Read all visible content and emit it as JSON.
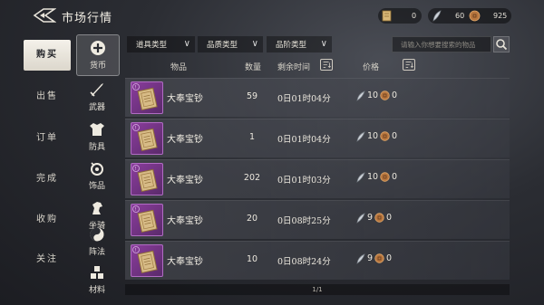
{
  "header": {
    "title": "市场行情"
  },
  "currency": [
    {
      "icon": "scroll-currency-icon",
      "value": "0"
    },
    {
      "icon": "feather-currency-icon",
      "value": "60"
    },
    {
      "icon": "coin-currency-icon",
      "value": "925"
    }
  ],
  "left_tabs": [
    {
      "label": "购买",
      "active": true
    },
    {
      "label": "出售"
    },
    {
      "label": "订单"
    },
    {
      "label": "完成"
    },
    {
      "label": "收购"
    },
    {
      "label": "关注"
    }
  ],
  "categories": [
    {
      "label": "货币",
      "icon": "coin-plus-icon",
      "active": true
    },
    {
      "label": "武器",
      "icon": "sword-icon"
    },
    {
      "label": "防具",
      "icon": "armor-icon"
    },
    {
      "label": "饰品",
      "icon": "ornament-icon"
    },
    {
      "label": "坐骑",
      "icon": "horse-icon"
    },
    {
      "label": "阵法",
      "icon": "formation-icon"
    },
    {
      "label": "材料",
      "icon": "material-icon"
    }
  ],
  "filters": {
    "item_type": "道具类型",
    "quality_type": "品质类型",
    "grade_type": "品阶类型",
    "search_placeholder": "请输入你想要搜索的物品"
  },
  "table": {
    "headers": {
      "item": "物品",
      "qty": "数量",
      "time": "剩余时间",
      "price": "价格"
    },
    "rows": [
      {
        "name": "大奉宝钞",
        "qty": "59",
        "time": "0日01时04分",
        "price_a": "10",
        "price_b": "0"
      },
      {
        "name": "大奉宝钞",
        "qty": "1",
        "time": "0日01时04分",
        "price_a": "10",
        "price_b": "0"
      },
      {
        "name": "大奉宝钞",
        "qty": "202",
        "time": "0日01时03分",
        "price_a": "10",
        "price_b": "0"
      },
      {
        "name": "大奉宝钞",
        "qty": "20",
        "time": "0日08时25分",
        "price_a": "9",
        "price_b": "0"
      },
      {
        "name": "大奉宝钞",
        "qty": "10",
        "time": "0日08时24分",
        "price_a": "9",
        "price_b": "0"
      }
    ]
  },
  "pagination": {
    "label": "1/1"
  },
  "colors": {
    "accent_item": "#8a3d9c",
    "active_tab": "#f4f1ea"
  }
}
